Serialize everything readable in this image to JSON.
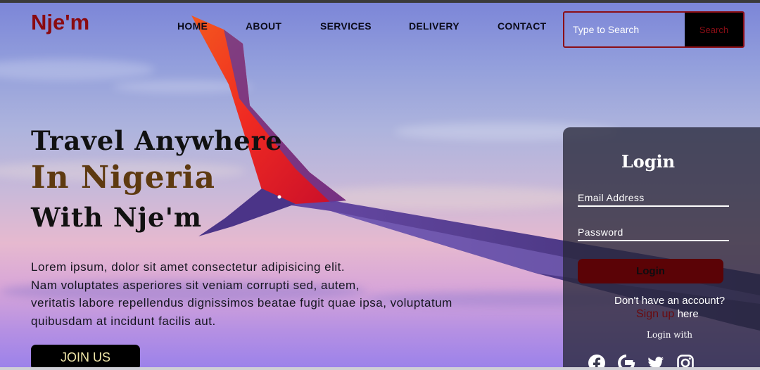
{
  "brand": {
    "logo": "Nje'm"
  },
  "nav": {
    "items": [
      "HOME",
      "ABOUT",
      "SERVICES",
      "DELIVERY",
      "CONTACT"
    ]
  },
  "search": {
    "placeholder": "Type to Search",
    "button_label": "Search"
  },
  "hero": {
    "line1": "Travel Anywhere",
    "line2": "In Nigeria",
    "line3": "With Nje'm",
    "paragraph_lines": [
      "Lorem ipsum, dolor sit amet consectetur adipisicing elit.",
      "Nam voluptates asperiores sit veniam corrupti sed, autem,",
      "veritatis labore repellendus dignissimos beatae fugit quae ipsa, voluptatum",
      "quibusdam at incidunt facilis aut."
    ],
    "cta_label": "JOIN US"
  },
  "login": {
    "title": "Login",
    "email_placeholder": "Email Address",
    "password_placeholder": "Password",
    "button_label": "Login",
    "no_account_text": "Don't have an account?",
    "signup_link": "Sign up",
    "signup_suffix": "here",
    "login_with": "Login with",
    "social": [
      "facebook-icon",
      "google-icon",
      "twitter-icon",
      "instagram-icon"
    ]
  },
  "colors": {
    "brand": "#8a0a10",
    "accent_dark": "#5b0306",
    "headline_brown": "#5e3a10",
    "search_border": "#8b0e16",
    "wing_red": "#e8102a",
    "wing_orange": "#f4581e"
  }
}
